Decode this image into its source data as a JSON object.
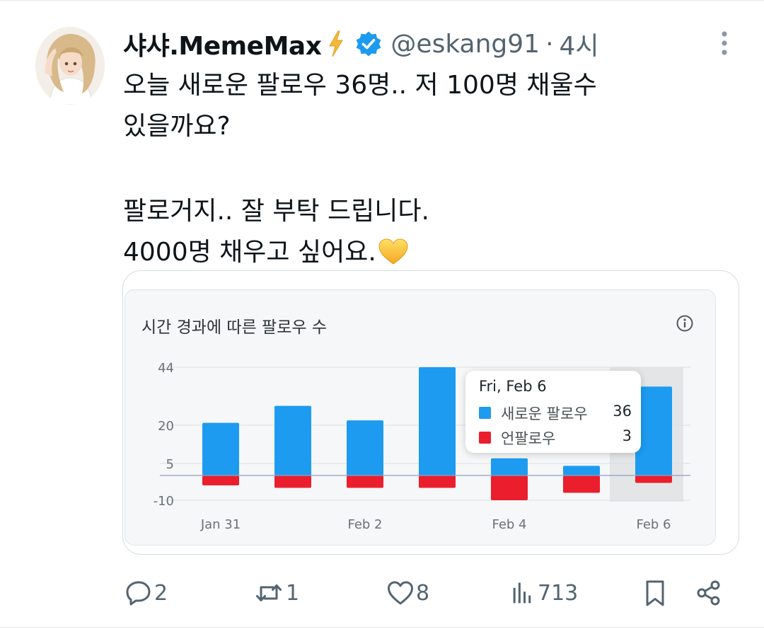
{
  "tweet": {
    "display_name": "샤샤.MemeMax",
    "handle": "@eskang91",
    "separator": "·",
    "time": "4시",
    "text_lines": [
      "오늘 새로운 팔로우 36명..  저 100명 채울수",
      "있을까요?",
      "",
      "팔로거지.. 잘 부탁 드립니다.",
      "4000명 채우고 싶어요."
    ],
    "emoji": "yellow-heart-icon"
  },
  "colors": {
    "new_follow": "#1d9bf0",
    "unfollow": "#ea1e2d",
    "verified": "#1d9bf0",
    "muted": "#536471"
  },
  "card": {
    "title": "시간 경과에 따른 팔로우 수",
    "tooltip": {
      "date": "Fri, Feb 6",
      "rows": [
        {
          "label": "새로운 팔로우",
          "value": "36"
        },
        {
          "label": "언팔로우",
          "value": "3"
        }
      ]
    }
  },
  "chart_data": {
    "type": "bar",
    "title": "시간 경과에 따른 팔로우 수",
    "categories": [
      "Jan 31",
      "Feb 1",
      "Feb 2",
      "Feb 3",
      "Feb 4",
      "Feb 5",
      "Feb 6"
    ],
    "tick_labels_x": [
      "Jan 31",
      "Feb 2",
      "Feb 4",
      "Feb 6"
    ],
    "tick_labels_y": [
      "44",
      "20",
      "5",
      "-10"
    ],
    "series": [
      {
        "name": "새로운 팔로우",
        "values": [
          21,
          28,
          22,
          44,
          7,
          4,
          36
        ]
      },
      {
        "name": "언팔로우",
        "values": [
          -4,
          -5,
          -5,
          -5,
          -10,
          -7,
          -3
        ]
      }
    ],
    "ylim": [
      -10,
      44
    ],
    "stacked": true,
    "highlighted_category": "Feb 6"
  },
  "actions": {
    "reply_count": "2",
    "retweet_count": "1",
    "like_count": "8",
    "view_count": "713"
  }
}
